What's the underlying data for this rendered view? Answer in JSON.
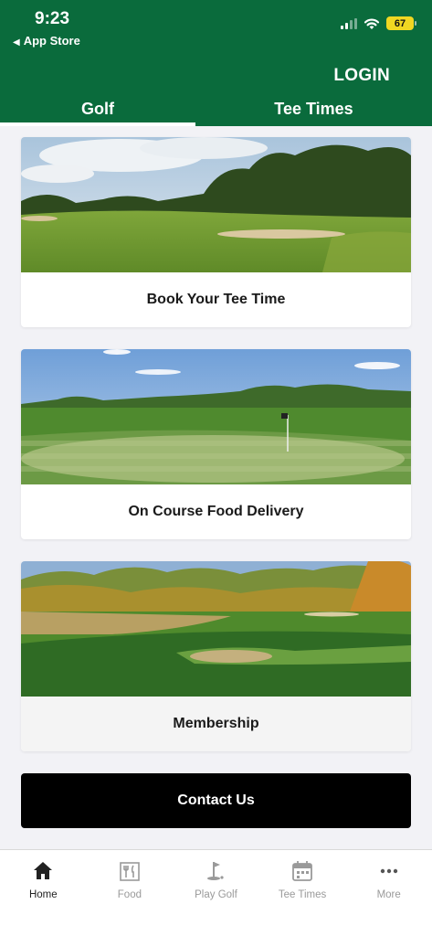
{
  "status": {
    "time": "9:23",
    "back_label": "App Store",
    "battery": "67"
  },
  "header": {
    "login_label": "LOGIN"
  },
  "tabs": [
    {
      "label": "Golf"
    },
    {
      "label": "Tee Times"
    }
  ],
  "cards": [
    {
      "label": "Book Your Tee Time"
    },
    {
      "label": "On Course Food Delivery"
    },
    {
      "label": "Membership"
    }
  ],
  "contact_label": "Contact Us",
  "nav": [
    {
      "label": "Home",
      "icon": "home-icon"
    },
    {
      "label": "Food",
      "icon": "food-icon"
    },
    {
      "label": "Play Golf",
      "icon": "golf-flag-icon"
    },
    {
      "label": "Tee Times",
      "icon": "calendar-icon"
    },
    {
      "label": "More",
      "icon": "more-icon"
    }
  ],
  "colors": {
    "brand": "#0a6b3c",
    "nav_active": "#222222",
    "nav_inactive": "#9a9a9a"
  }
}
